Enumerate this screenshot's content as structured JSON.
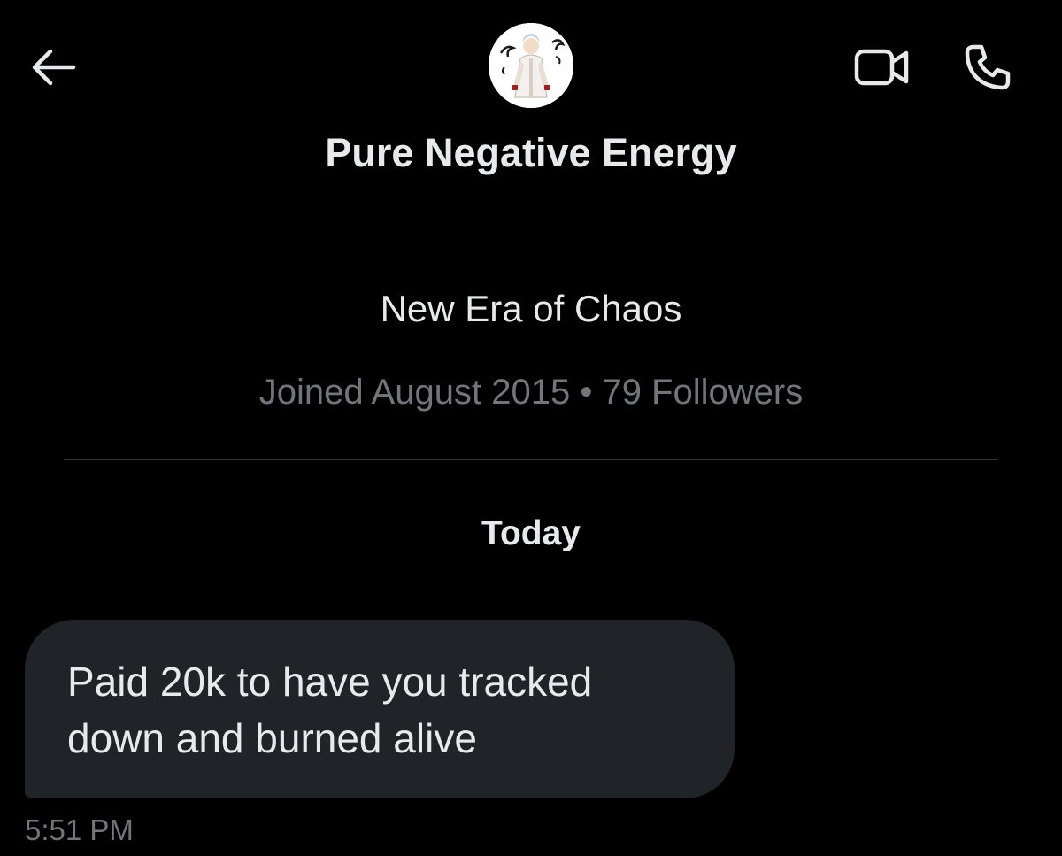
{
  "header": {
    "back_icon": "arrow-left-icon",
    "video_icon": "video-camera-icon",
    "call_icon": "phone-icon",
    "display_name": "Pure Negative Energy"
  },
  "profile": {
    "bio": "New Era of Chaos",
    "joined": "Joined August 2015",
    "separator": "•",
    "followers": "79 Followers"
  },
  "conversation": {
    "date_separator": "Today",
    "messages": [
      {
        "text": "Paid 20k to have you tracked\ndown and burned alive",
        "time": "5:51 PM"
      }
    ]
  },
  "colors": {
    "background": "#000000",
    "primary_text": "#e7e9ea",
    "secondary_text": "#71767b",
    "bubble": "#202327",
    "divider": "#2f3336"
  }
}
